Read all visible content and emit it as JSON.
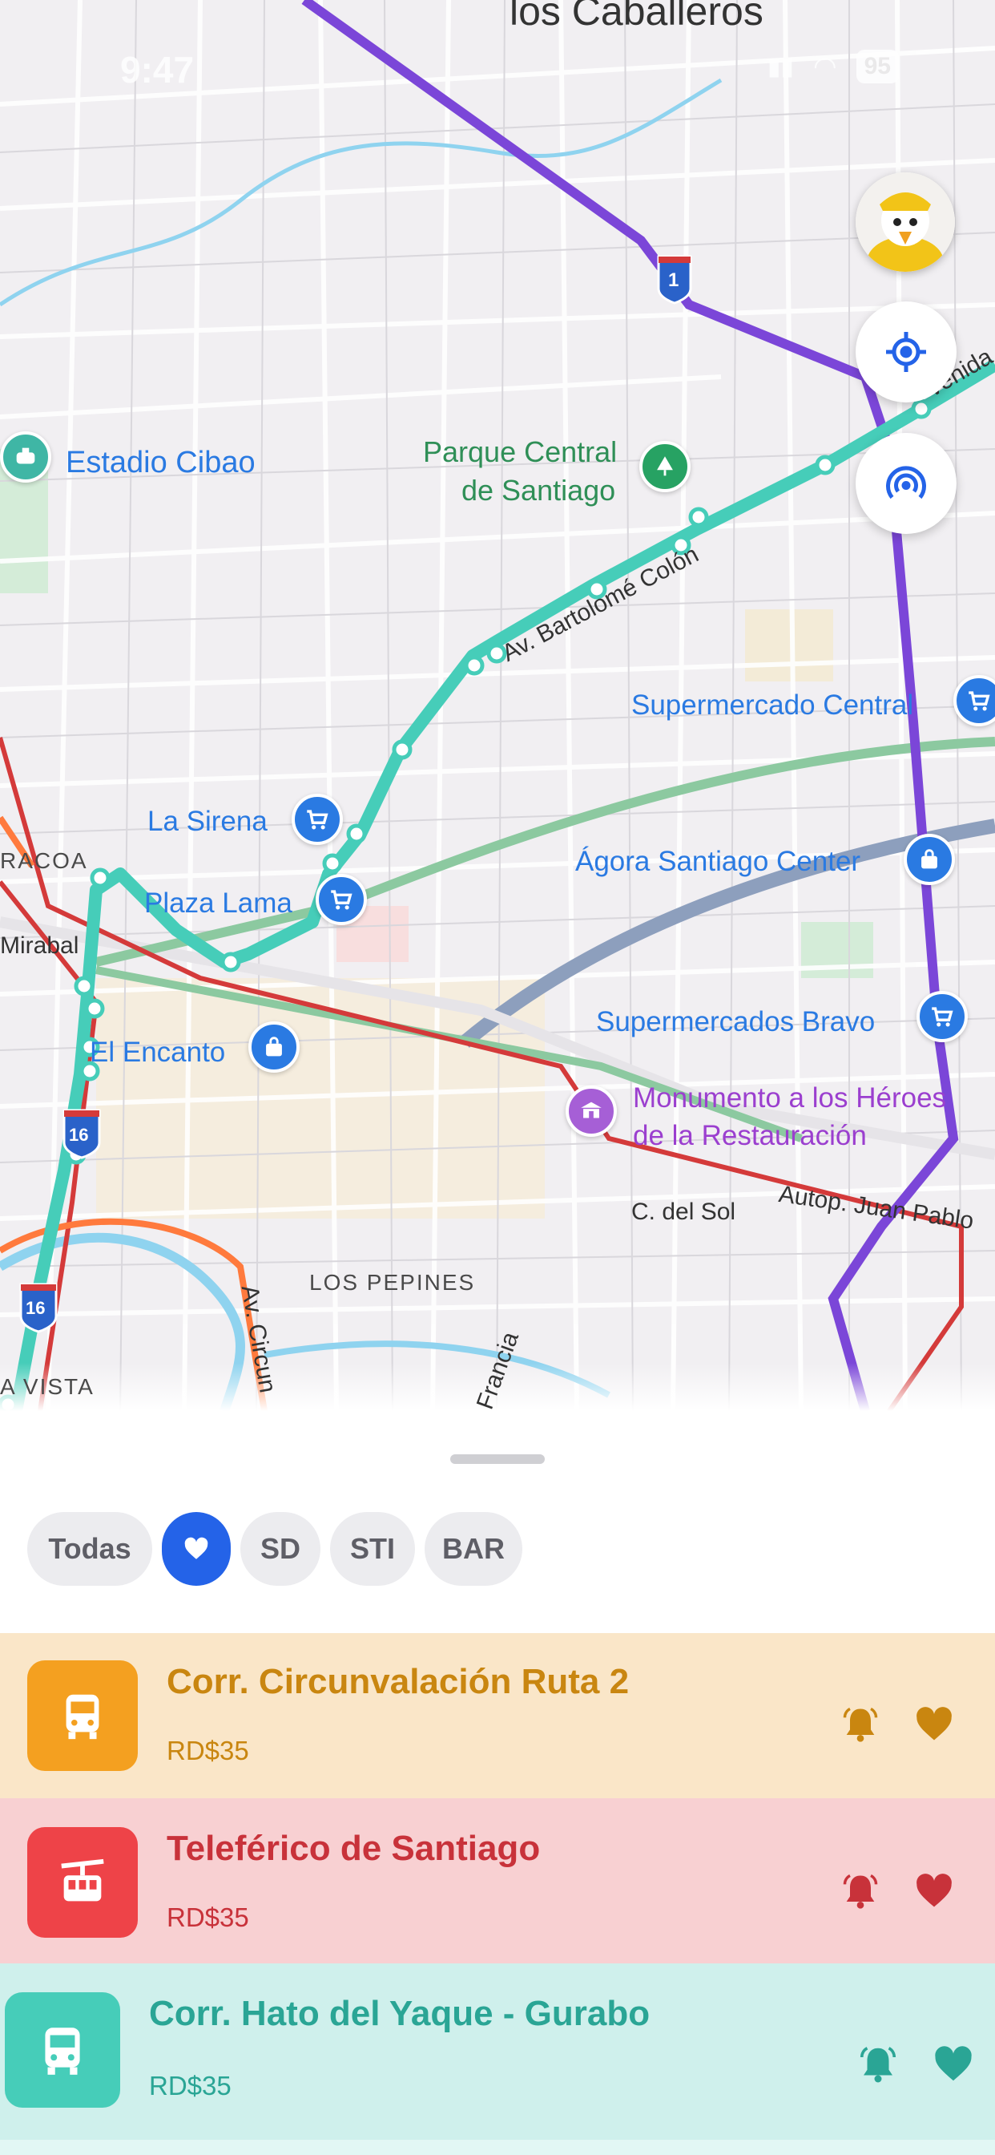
{
  "status_bar": {
    "time": "9:47",
    "battery": "95"
  },
  "map": {
    "top_label": "los Caballeros",
    "places": {
      "estadio": "Estadio Cibao",
      "parque_1": "Parque Central",
      "parque_2": "de Santiago",
      "sirena": "La Sirena",
      "plaza_lama": "Plaza Lama",
      "supermercado_central": "Supermercado Central",
      "agora": "Ágora Santiago Center",
      "bravo": "Supermercados Bravo",
      "encanto": "El Encanto",
      "monumento_1": "Monumento a los Héroes",
      "monumento_2": "de la Restauración",
      "los_pepines": "LOS PEPINES",
      "racoa": "RACOA",
      "mirabal": "Mirabal",
      "vista": "A VISTA",
      "c_del_sol": "C. del Sol",
      "autop": "Autop. Juan Pablo",
      "francia": "Francia",
      "av_circun": "Av. Circun",
      "av_bartolome": "Av. Bartolomé Colón",
      "avenida": "venida",
      "shield_1": "1",
      "shield_16a": "16",
      "shield_16b": "16"
    },
    "icons": {
      "locate": "location-target-icon",
      "broadcast": "broadcast-icon"
    }
  },
  "filters": {
    "chips": [
      "Todas",
      "",
      "SD",
      "STI",
      "BAR"
    ],
    "selected": "favorites-heart"
  },
  "routes": [
    {
      "title": "Corr. Circunvalación Ruta 2",
      "price": "RD$35",
      "color": "#c98610",
      "bg": "#fae6c8",
      "icon_bg": "#f4a020",
      "icon": "bus-icon"
    },
    {
      "title": "Teleférico de Santiago",
      "price": "RD$35",
      "color": "#c8323a",
      "bg": "#f8d0d2",
      "icon_bg": "#ee4348",
      "icon": "cable-car-icon"
    },
    {
      "title": "Corr. Hato del Yaque - Gurabo",
      "price": "RD$35",
      "color": "#2aa595",
      "bg": "#cff0ec",
      "icon_bg": "#46cdb9",
      "icon": "bus-icon"
    }
  ]
}
